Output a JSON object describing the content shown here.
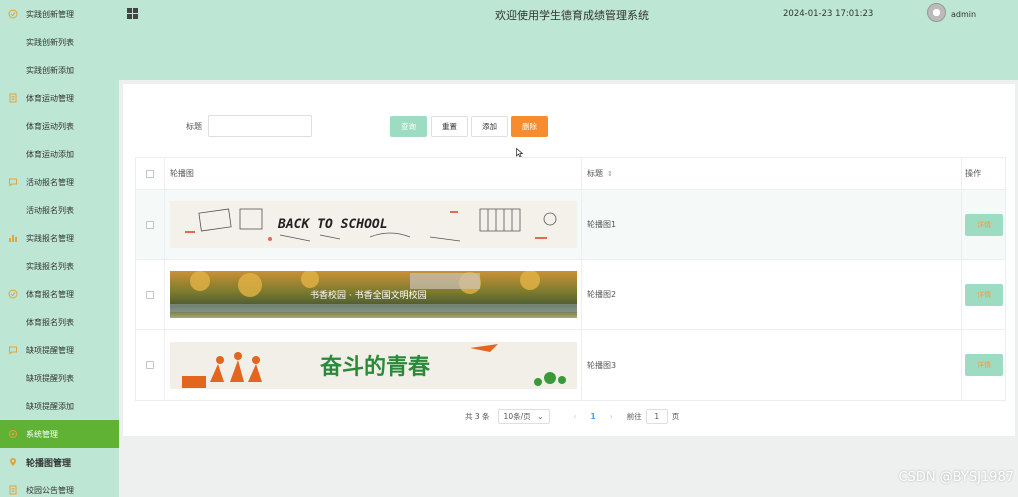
{
  "sidebar": {
    "items": [
      {
        "label": "实践创新管理",
        "type": "group",
        "icon": "check-circle-icon"
      },
      {
        "label": "实践创新列表",
        "type": "sub"
      },
      {
        "label": "实践创新添加",
        "type": "sub"
      },
      {
        "label": "体育运动管理",
        "type": "group",
        "icon": "document-icon"
      },
      {
        "label": "体育运动列表",
        "type": "sub"
      },
      {
        "label": "体育运动添加",
        "type": "sub"
      },
      {
        "label": "活动报名管理",
        "type": "group",
        "icon": "chat-icon"
      },
      {
        "label": "活动报名列表",
        "type": "sub"
      },
      {
        "label": "实践报名管理",
        "type": "group",
        "icon": "bar-chart-icon"
      },
      {
        "label": "实践报名列表",
        "type": "sub"
      },
      {
        "label": "体育报名管理",
        "type": "group",
        "icon": "check-circle-icon"
      },
      {
        "label": "体育报名列表",
        "type": "sub"
      },
      {
        "label": "缺项提醒管理",
        "type": "group",
        "icon": "chat-icon"
      },
      {
        "label": "缺项提醒列表",
        "type": "sub"
      },
      {
        "label": "缺项提醒添加",
        "type": "sub"
      },
      {
        "label": "系统管理",
        "type": "group",
        "icon": "settings-icon",
        "active": true
      },
      {
        "label": "轮播图管理",
        "type": "group",
        "icon": "location-icon",
        "bold": true
      },
      {
        "label": "校园公告管理",
        "type": "group",
        "icon": "document-icon"
      }
    ]
  },
  "header": {
    "title": "欢迎使用学生德育成绩管理系统",
    "datetime": "2024-01-23 17:01:23",
    "username": "admin"
  },
  "search": {
    "label": "标题",
    "value": "",
    "query_label": "查询",
    "reset_label": "重置",
    "add_label": "添加",
    "delete_label": "删除"
  },
  "table": {
    "columns": {
      "image": "轮播图",
      "title": "标题",
      "ops": "操作"
    },
    "rows": [
      {
        "title": "轮播图1",
        "detail_label": "详情",
        "banner_text": "BACK TO SCHOOL"
      },
      {
        "title": "轮播图2",
        "detail_label": "详情",
        "banner_text": "书香校园 · 书香全国文明校园"
      },
      {
        "title": "轮播图3",
        "detail_label": "详情",
        "banner_text": "奋斗的青春"
      }
    ]
  },
  "pagination": {
    "total": "共 3 条",
    "page_size": "10条/页",
    "current_page": "1",
    "goto_label": "前往",
    "goto_value": "1",
    "page_suffix": "页"
  },
  "watermark": "CSDN @BYSJ1987",
  "colors": {
    "sidebar_bg": "#bde6d4",
    "active_item": "#5fb233",
    "primary_btn": "#9ddcc2",
    "danger_btn": "#f78c2e"
  }
}
